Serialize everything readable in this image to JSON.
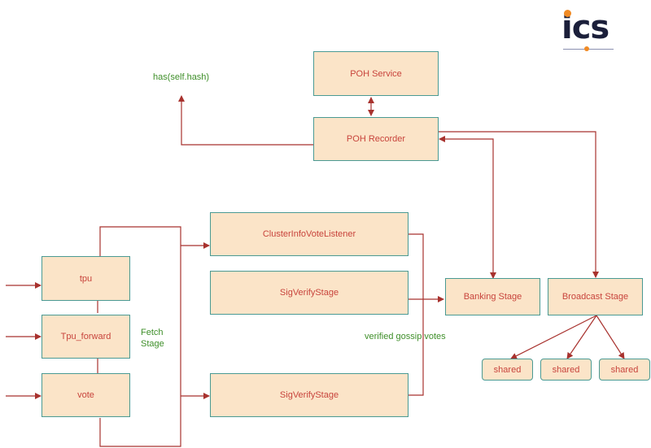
{
  "logo": {
    "text": "ics",
    "accent_color": "#f08a24",
    "text_color": "#1b1f3a"
  },
  "colors": {
    "node_fill": "#fbe4c8",
    "node_border": "#4a9a93",
    "node_text": "#c8443c",
    "edge": "#a8322e",
    "annotation": "#3f8f2a"
  },
  "nodes": {
    "poh_service": "POH Service",
    "poh_recorder": "POH Recorder",
    "cluster_info_vote_listener": "ClusterInfoVoteListener",
    "sig_verify_stage_1": "SigVerifyStage",
    "sig_verify_stage_2": "SigVerifyStage",
    "tpu": "tpu",
    "tpu_forward": "Tpu_forward",
    "vote": "vote",
    "banking_stage": "Banking Stage",
    "broadcast_stage": "Broadcast Stage",
    "shared_1": "shared",
    "shared_2": "shared",
    "shared_3": "shared"
  },
  "annotations": {
    "hash": "has(self.hash)",
    "fetch_stage_line1": "Fetch",
    "fetch_stage_line2": "Stage",
    "verified_gossip_votes": "verified gossip votes"
  }
}
